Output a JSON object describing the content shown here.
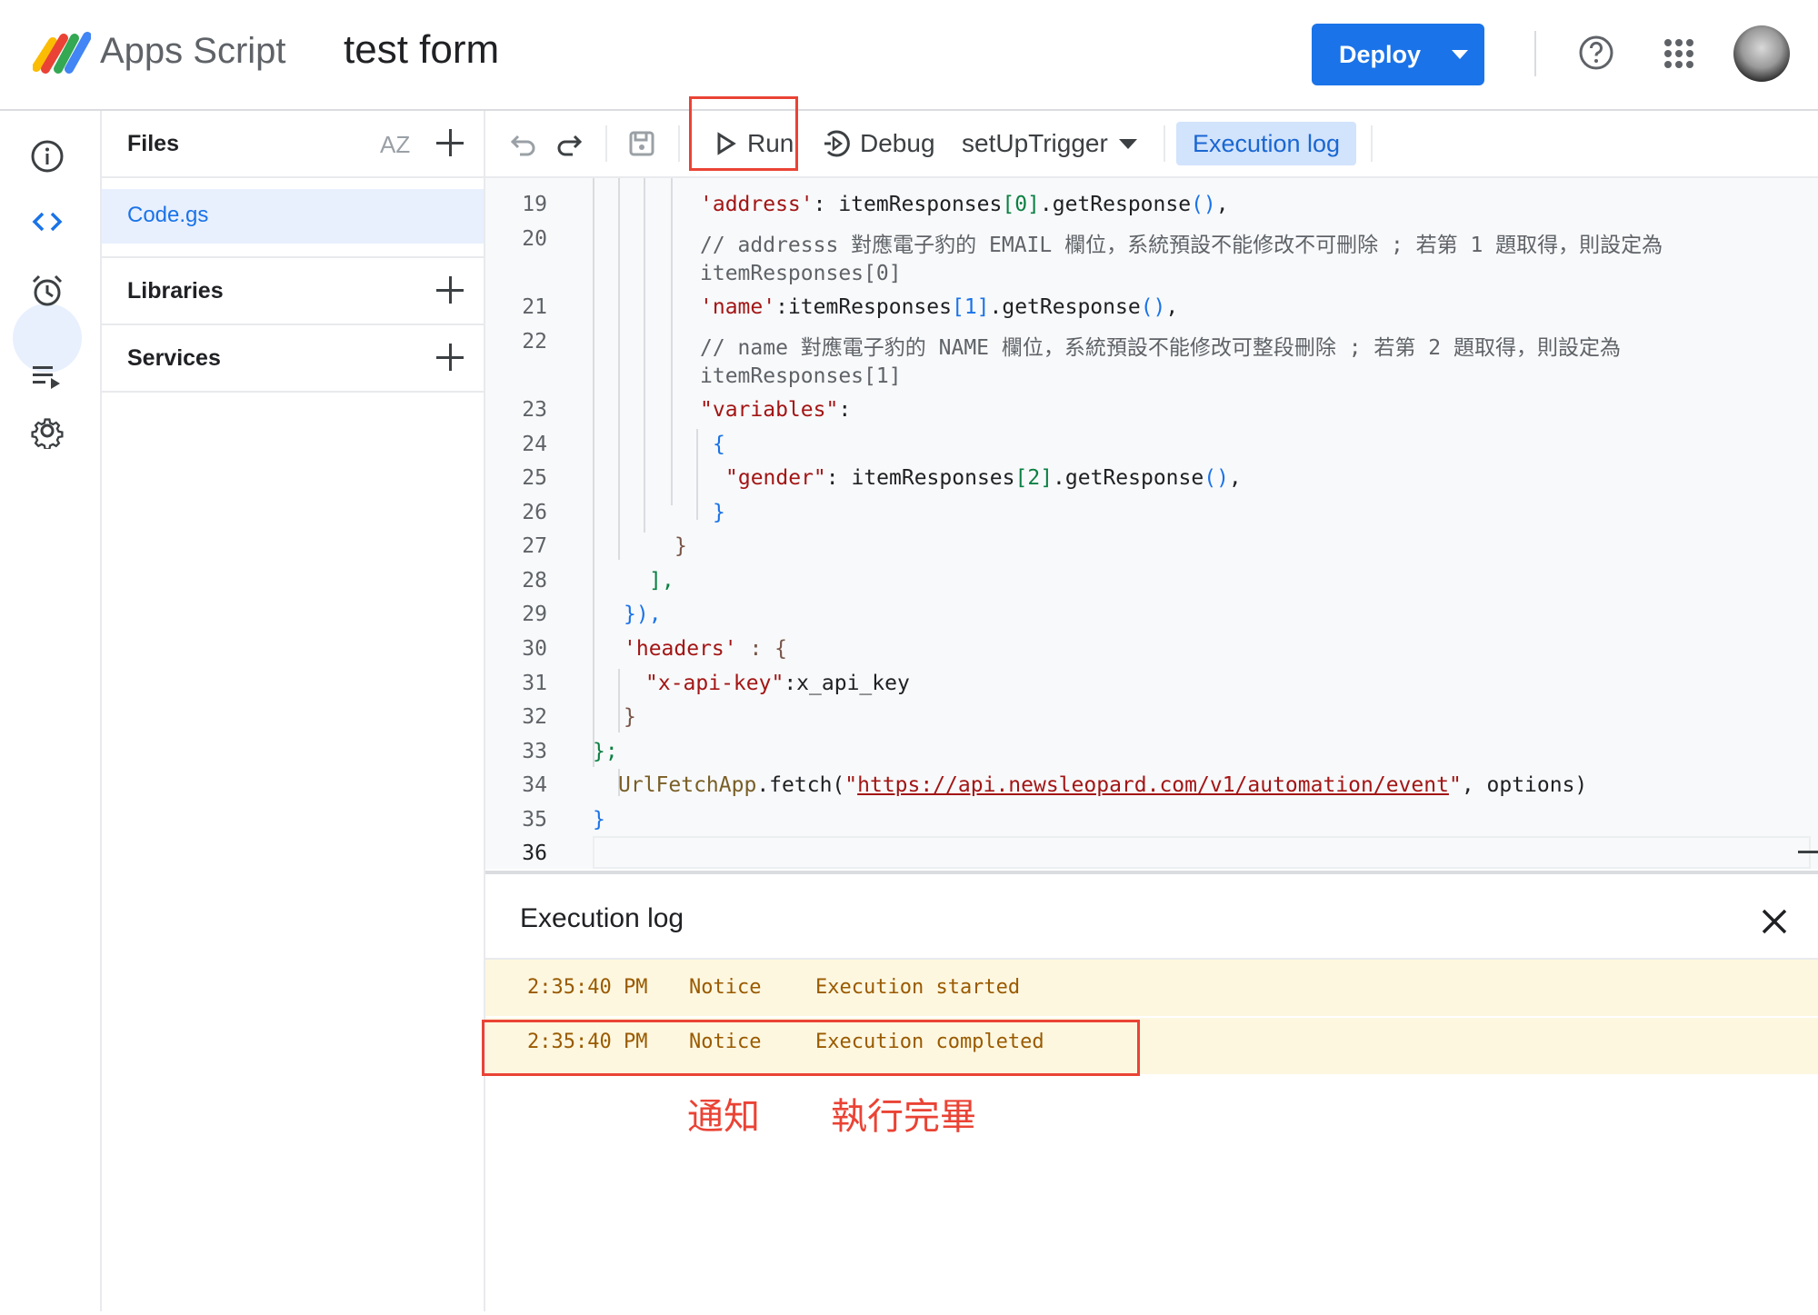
{
  "header": {
    "app_name": "Apps Script",
    "project_name": "test form",
    "deploy_label": "Deploy"
  },
  "rail": [
    "info-icon",
    "code-icon",
    "alarm-icon",
    "executions-icon",
    "settings-icon"
  ],
  "files_panel": {
    "files_label": "Files",
    "sort_label": "AZ",
    "file_name": "Code.gs",
    "libraries_label": "Libraries",
    "services_label": "Services"
  },
  "toolbar": {
    "run_label": "Run",
    "debug_label": "Debug",
    "function_select": "setUpTrigger",
    "execution_log_label": "Execution log"
  },
  "editor": {
    "line_numbers": [
      "19",
      "20",
      "21",
      "22",
      "23",
      "24",
      "25",
      "26",
      "27",
      "28",
      "29",
      "30",
      "31",
      "32",
      "33",
      "34",
      "35",
      "36"
    ],
    "l19_key": "'address'",
    "l19_rest": ": itemResponses",
    "l19_idx": "[0]",
    "l19_call": ".getResponse",
    "l19_paren": "()",
    "l19_end": ",",
    "l20a": "// addresss 對應電子豹的 EMAIL 欄位，系統預設不能修改不可刪除 ; 若第 1 題取得，則設定為",
    "l20b": "itemResponses[0]",
    "l21_key": "'name'",
    "l21_rest": ":itemResponses",
    "l21_idx": "[1]",
    "l21_call": ".getResponse",
    "l21_paren": "()",
    "l21_end": ",",
    "l22a": "// name 對應電子豹的 NAME 欄位，系統預設不能修改可整段刪除 ; 若第 2 題取得，則設定為",
    "l22b": "itemResponses[1]",
    "l23_key": "\"variables\"",
    "l23_end": ":",
    "l24": "{",
    "l25_key": "\"gender\"",
    "l25_rest": ": itemResponses",
    "l25_idx": "[2]",
    "l25_call": ".getResponse",
    "l25_paren": "()",
    "l25_end": ",",
    "l26": "}",
    "l27": "}",
    "l28": "],",
    "l29": "}),",
    "l30_key": "'headers'",
    "l30_rest": " : {",
    "l31_key": "\"x-api-key\"",
    "l31_rest": ":x_api_key",
    "l32": "}",
    "l33": "};",
    "l34_obj": "UrlFetchApp",
    "l34_call": ".fetch(",
    "l34_q1": "\"",
    "l34_url": "https://api.newsleopard.com/v1/automation/event",
    "l34_q2": "\"",
    "l34_rest": ", options)",
    "l35": "}"
  },
  "execution_log": {
    "title": "Execution log",
    "rows": [
      {
        "time": "2:35:40 PM",
        "level": "Notice",
        "message": "Execution started"
      },
      {
        "time": "2:35:40 PM",
        "level": "Notice",
        "message": "Execution completed"
      }
    ],
    "annotation_notice": "通知",
    "annotation_completed": "執行完畢"
  },
  "colors": {
    "accent": "#1a73e8",
    "highlight_box": "#ea4335",
    "log_row_bg": "#fef7e0"
  }
}
